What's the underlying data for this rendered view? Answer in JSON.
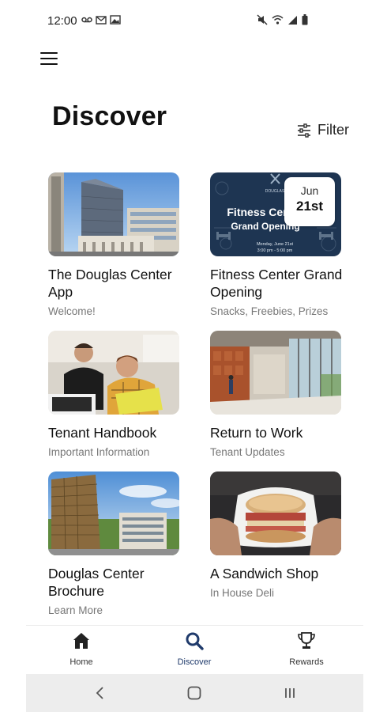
{
  "status_bar": {
    "time": "12:00",
    "left_icons": [
      "voicemail-icon",
      "gmail-icon",
      "image-icon"
    ],
    "right_icons": [
      "mute-icon",
      "wifi-icon",
      "signal-icon",
      "battery-icon"
    ]
  },
  "header": {
    "title": "Discover",
    "filter_label": "Filter"
  },
  "cards": [
    {
      "title": "The Douglas Center App",
      "subtitle": "Welcome!"
    },
    {
      "title": "Fitness Center Grand Opening",
      "subtitle": "Snacks, Freebies, Prizes",
      "badge_month": "Jun",
      "badge_day": "21st",
      "poster_title_line1": "Fitness Center",
      "poster_title_line2": "Grand Opening",
      "poster_brand": "DOUGLAS",
      "poster_date": "Monday, June 21st",
      "poster_time": "3:00 pm - 5:00 pm"
    },
    {
      "title": "Tenant Handbook",
      "subtitle": "Important Information"
    },
    {
      "title": "Return to Work",
      "subtitle": "Tenant Updates"
    },
    {
      "title": "Douglas Center Brochure",
      "subtitle": "Learn More"
    },
    {
      "title": "A Sandwich Shop",
      "subtitle": "In House Deli"
    }
  ],
  "bottom_nav": {
    "items": [
      {
        "label": "Home",
        "icon": "home-icon"
      },
      {
        "label": "Discover",
        "icon": "search-icon",
        "active": true
      },
      {
        "label": "Rewards",
        "icon": "trophy-icon"
      }
    ]
  },
  "colors": {
    "active_nav": "#1f3a6b",
    "poster_navy": "#1e3552",
    "subtitle_gray": "#777777"
  }
}
